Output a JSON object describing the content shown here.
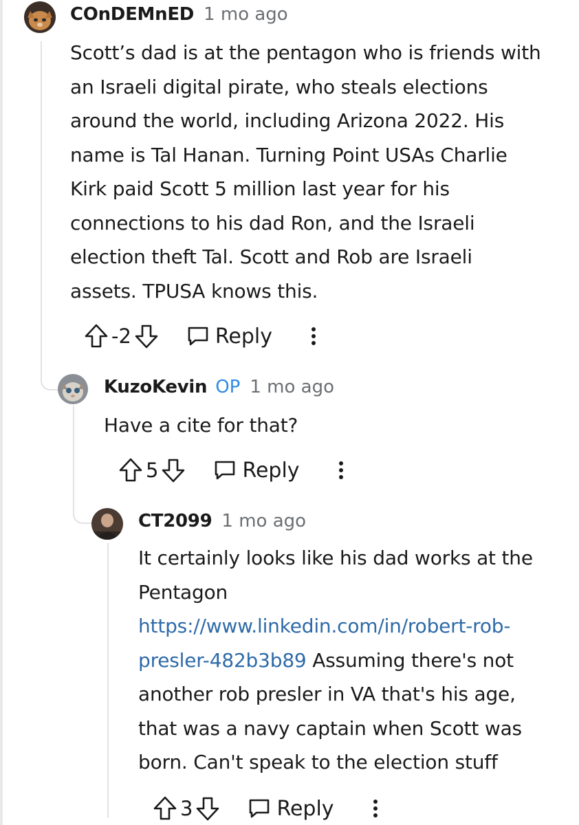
{
  "comments": [
    {
      "username": "COnDEMnED",
      "timestamp": "1 mo ago",
      "body_lines": [
        "Scott’s dad is at the pentagon who is friends with",
        "an Israeli digital pirate, who steals elections",
        "around the world, including Arizona 2022. His",
        "name is Tal Hanan. Turning Point USAs Charlie",
        "Kirk paid Scott 5 million last year for his",
        "connections to his dad Ron, and the Israeli",
        "election theft Tal. Scott and Rob are Israeli",
        "assets. TPUSA knows this."
      ],
      "score": "-2",
      "reply_label": "Reply"
    },
    {
      "username": "KuzoKevin",
      "badge": "OP",
      "timestamp": "1 mo ago",
      "body_lines": [
        "Have a cite for that?"
      ],
      "score": "5",
      "reply_label": "Reply"
    },
    {
      "username": "CT2099",
      "timestamp": "1 mo ago",
      "body_line_1": "It certainly looks like his dad works at the",
      "body_line_2": "Pentagon",
      "link_line_1": "https://www.linkedin.com/in/robert-rob-",
      "link_line_2": "presler-482b3b89",
      "body_line_4_rest": " Assuming there's not",
      "body_line_5": "another rob presler in VA that's his age,",
      "body_line_6": "that was a navy captain when Scott was",
      "body_line_7": "born. Can't speak to the election stuff",
      "score": "3",
      "reply_label": "Reply"
    }
  ],
  "colors": {
    "op_badge": "#2f8ae6",
    "link": "#2e6aa8",
    "timestamp": "#6b6e72",
    "thread_line": "#e2e2e2"
  },
  "icons": {
    "upvote": "arrow-up-outline-icon",
    "downvote": "arrow-down-outline-icon",
    "reply": "speech-bubble-icon",
    "more": "vertical-ellipsis-icon"
  }
}
